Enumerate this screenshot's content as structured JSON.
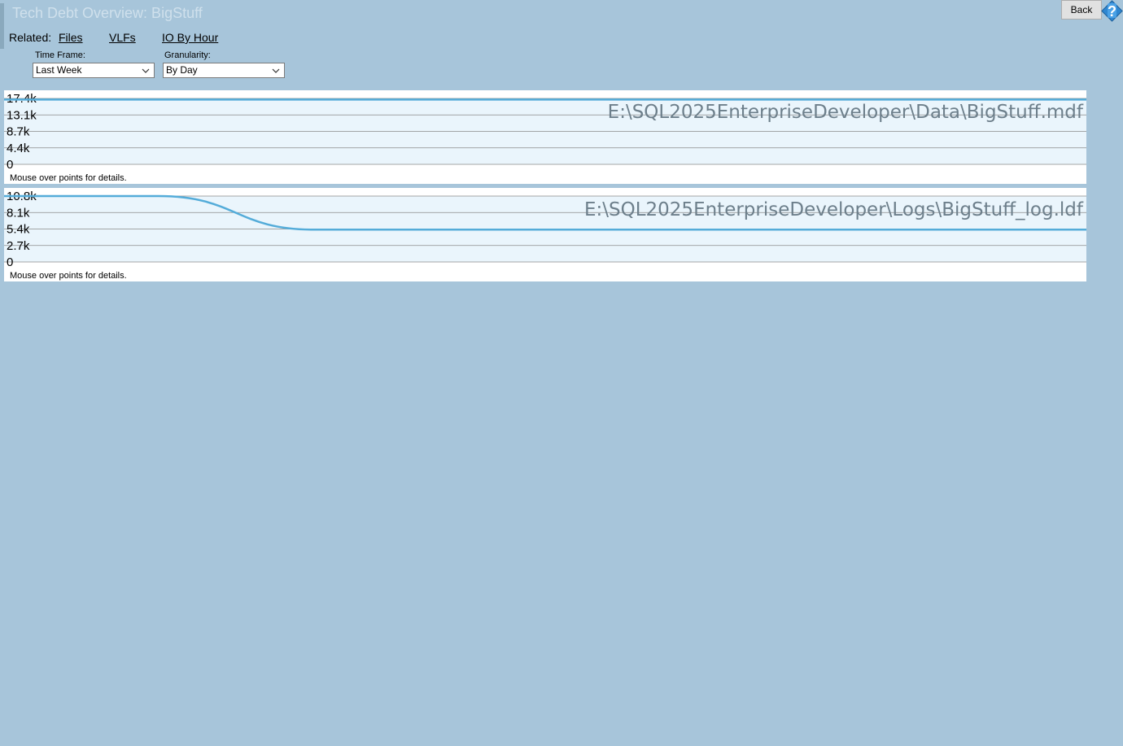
{
  "page": {
    "title": "Tech Debt Overview: BigStuff"
  },
  "related": {
    "label": "Related:",
    "links": [
      "Files",
      "VLFs",
      "IO By Hour"
    ]
  },
  "filters": {
    "time_frame": {
      "label": "Time Frame:",
      "value": "Last Week"
    },
    "granularity": {
      "label": "Granularity:",
      "value": "By Day"
    }
  },
  "toolbar": {
    "back_label": "Back",
    "help_icon": "help-question-icon"
  },
  "colors": {
    "background": "#a7c5da",
    "series_line": "#54acd9",
    "plot_fill": "#eaf5fc",
    "title_text": "#6d7f8b"
  },
  "chart_data": [
    {
      "type": "area",
      "title": "E:\\SQL2025EnterpriseDeveloper\\Data\\BigStuff.mdf",
      "y_ticks": [
        "0",
        "4.4k",
        "8.7k",
        "13.1k",
        "17.4k"
      ],
      "ylim": [
        0,
        17400
      ],
      "series": [
        {
          "values": [
            17100,
            17100,
            17100,
            17100,
            17100,
            17100,
            17100,
            17100
          ]
        }
      ],
      "hint": "Mouse over points for details."
    },
    {
      "type": "area",
      "title": "E:\\SQL2025EnterpriseDeveloper\\Logs\\BigStuff_log.ldf",
      "y_ticks": [
        "0",
        "2.7k",
        "5.4k",
        "8.1k",
        "10.8k"
      ],
      "ylim": [
        0,
        10800
      ],
      "series": [
        {
          "values": [
            10800,
            10800,
            5300,
            5300,
            5300,
            5300,
            5300,
            5300
          ]
        }
      ],
      "hint": "Mouse over points for details."
    }
  ]
}
